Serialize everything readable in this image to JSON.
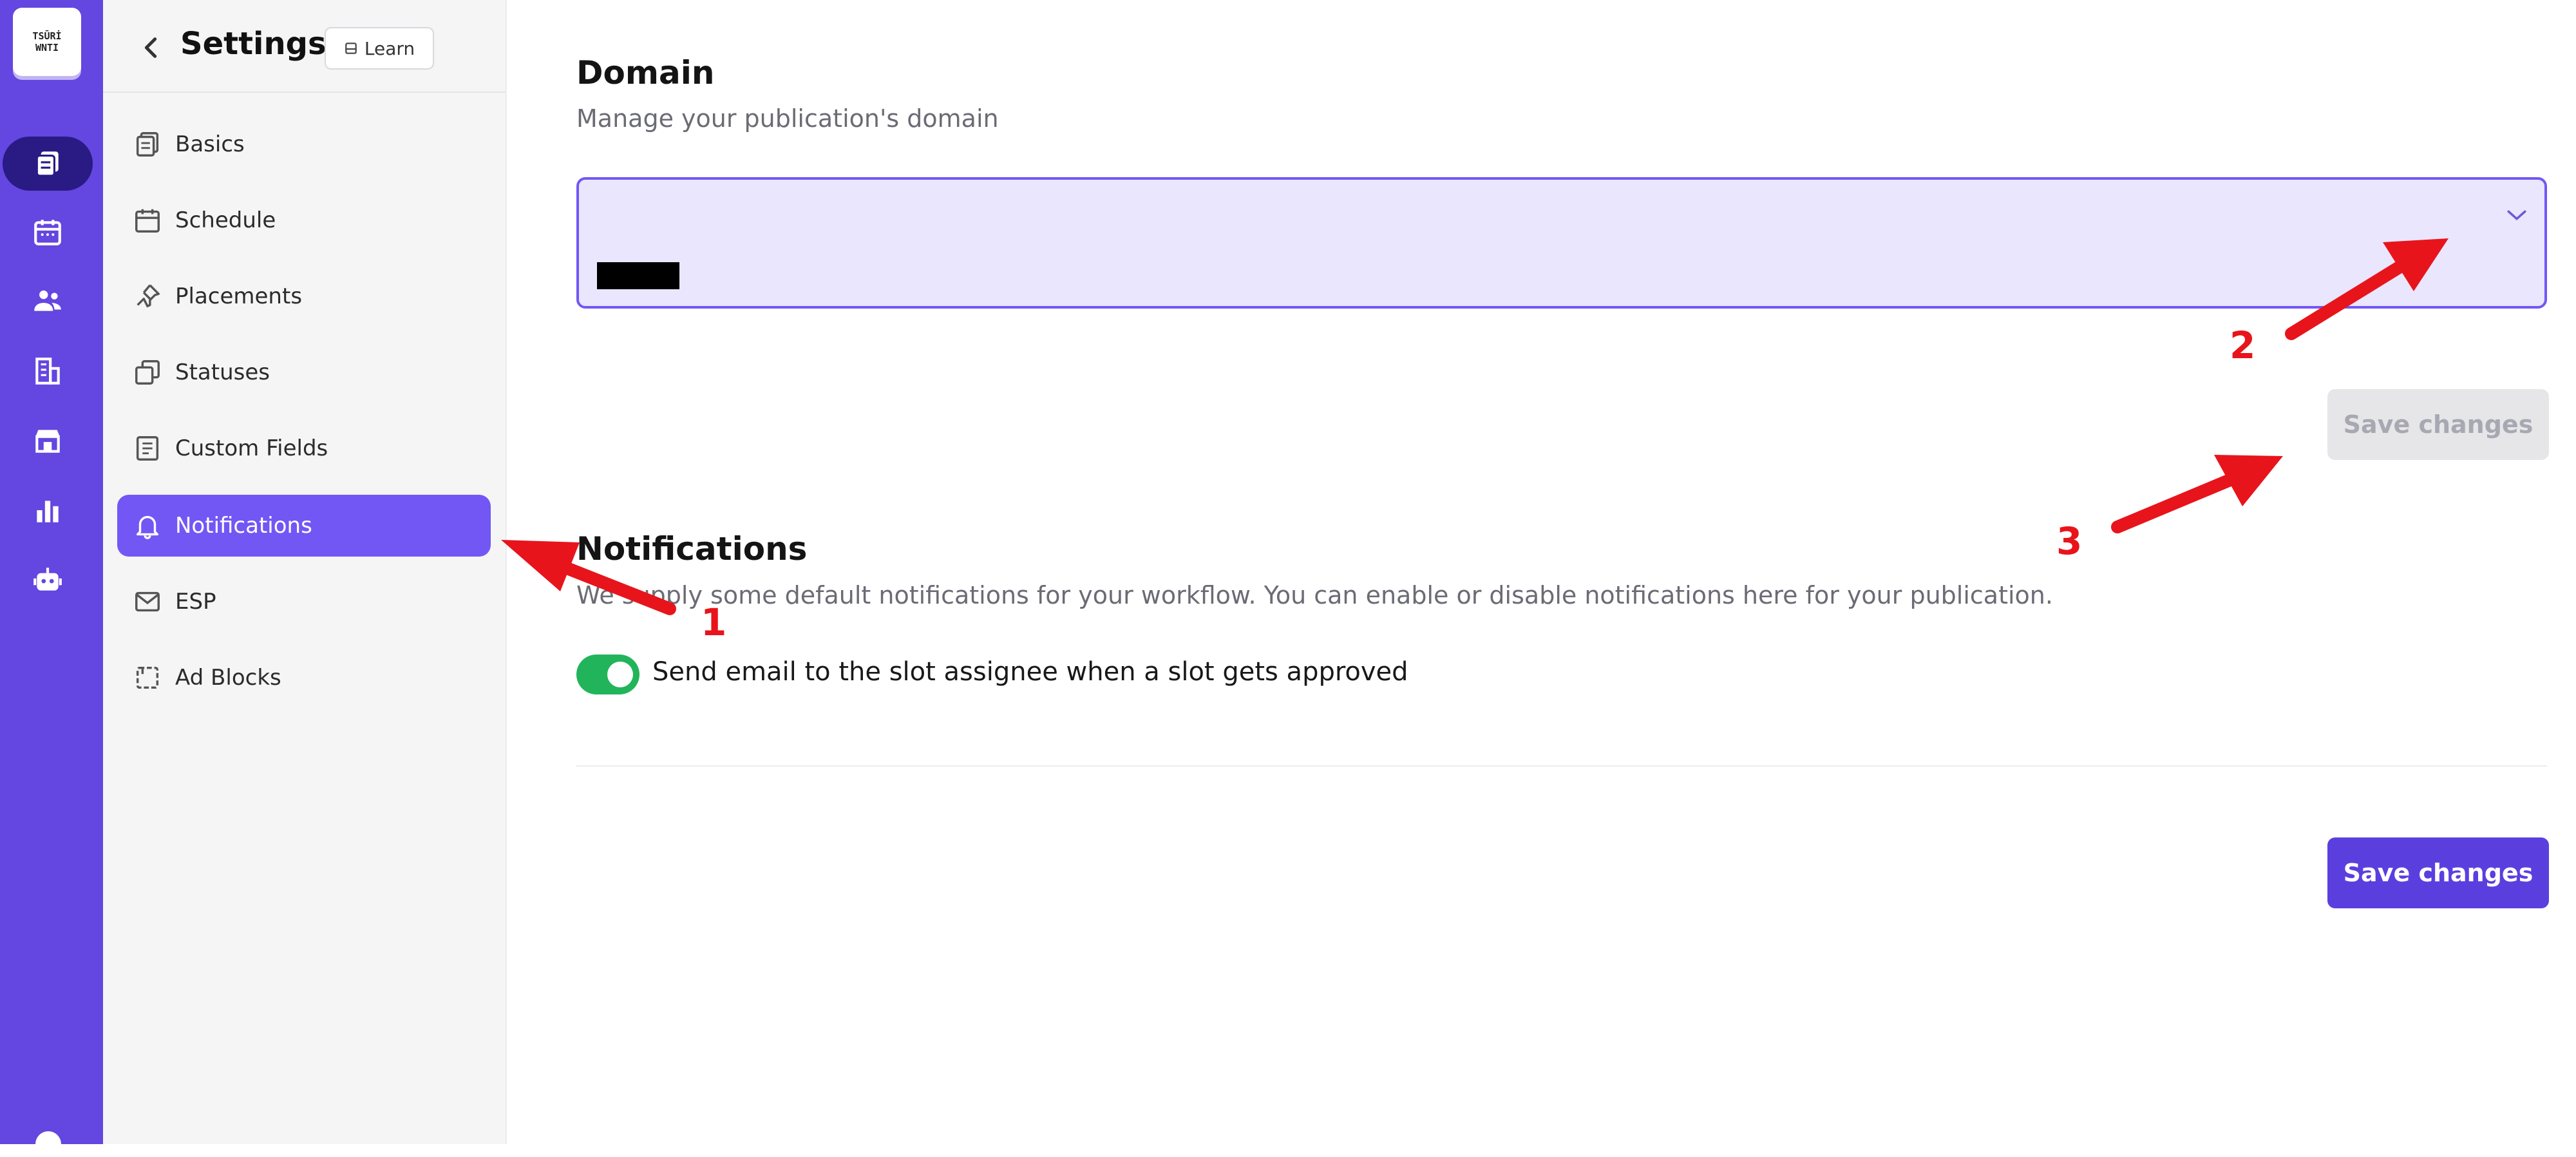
{
  "logo": {
    "line1": "TSŪRİ",
    "line2": "WNTI"
  },
  "rail": {
    "items": [
      {
        "icon": "documents-icon",
        "active": true
      },
      {
        "icon": "calendar-icon",
        "active": false
      },
      {
        "icon": "people-icon",
        "active": false
      },
      {
        "icon": "building-icon",
        "active": false
      },
      {
        "icon": "storefront-icon",
        "active": false
      },
      {
        "icon": "bar-chart-icon",
        "active": false
      },
      {
        "icon": "robot-icon",
        "active": false
      }
    ]
  },
  "sidebar": {
    "title": "Settings",
    "learn_label": "Learn",
    "items": [
      {
        "label": "Basics",
        "icon": "document-stack-icon"
      },
      {
        "label": "Schedule",
        "icon": "calendar-icon"
      },
      {
        "label": "Placements",
        "icon": "pin-icon"
      },
      {
        "label": "Statuses",
        "icon": "squares-icon"
      },
      {
        "label": "Custom Fields",
        "icon": "form-icon"
      },
      {
        "label": "Notifications",
        "icon": "bell-icon",
        "active": true
      },
      {
        "label": "ESP",
        "icon": "envelope-icon"
      },
      {
        "label": "Ad Blocks",
        "icon": "block-icon"
      }
    ]
  },
  "domain": {
    "title": "Domain",
    "subtitle": "Manage your publication's domain",
    "save_label": "Save changes"
  },
  "notifications": {
    "title": "Notifications",
    "subtitle": "We supply some default notifications for your workflow. You can enable or disable notifications here for your publication.",
    "toggle_label": "Send email to the slot assignee when a slot gets approved",
    "toggle_on": true
  },
  "footer": {
    "save_label": "Save changes"
  },
  "annotations": {
    "one": "1",
    "two": "2",
    "three": "3"
  },
  "colors": {
    "rail": "#6446e0",
    "accent": "#7257f5",
    "primary_button": "#5b3fde",
    "toggle_on": "#22b45a",
    "annotation_red": "#e8141b"
  }
}
